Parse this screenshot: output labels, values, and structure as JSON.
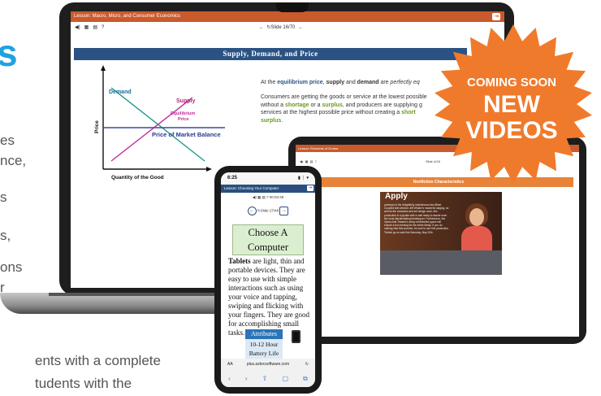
{
  "left_copy": {
    "heading_fragment": "s",
    "lines": [
      "es",
      "nce,",
      "s",
      "s,",
      "ons",
      "r"
    ],
    "bottom_lines": [
      "ents with a complete",
      "tudents with the"
    ]
  },
  "laptop": {
    "topbar_title": "Lesson: Macro, Micro, and Consumer Economics",
    "toolbar_icons": [
      "◀)",
      "▦",
      "▤",
      "?"
    ],
    "slide_nav": "Slide 16/70",
    "slide_title": "Supply, Demand, and Price",
    "chart": {
      "demand_label": "Demand",
      "supply_label": "Supply",
      "equilibrium_label_1": "Equilibrium",
      "equilibrium_label_2": "Price",
      "market_label": "Price of Market Balance",
      "y_axis": "Price",
      "x_axis": "Quantity of the Good"
    },
    "para1": {
      "a": "At the ",
      "b": "equilibrium price",
      "c": ", ",
      "d": "supply",
      "e": " and ",
      "f": "demand",
      "g": " are ",
      "h": "perfectly eq"
    },
    "para2": {
      "l1": "Consumers are getting the goods or service at the lowest possible",
      "l2a": "without a ",
      "l2b": "shortage",
      "l2c": " or a ",
      "l2d": "surplus",
      "l2e": ", and producers are supplying g",
      "l3a": "services at the highest possible price without creating a ",
      "l3b": "short",
      "l4a": "surplus",
      "l4b": "."
    }
  },
  "tablet": {
    "topbar_title": "Lesson: Elements of Drama",
    "slide_nav": "Slide 4/18",
    "banner": "Nonfiction Characteristics",
    "video_title": "Apply",
    "video_text": "portrayal of the delightfully mischievous fast-ffllasi. Coupled with director Jeff Whaler's masterful staging, as well as the costumes and set design work, this production is a joyride with a cast ready to dazzle even the most discriminating theatergoer. Furthermore, the Opera Arts Theatre's newly refurbished space will ensure a fun evening for the entire family. If you do nothing else this summer, be sure to see this production. Tickets go on sale this Saturday, May 20th."
  },
  "phone": {
    "status_time": "6:25",
    "status_right": "▮ ⋮ ▾",
    "topbar_title": "Lesson: Choosing Your Computer",
    "toolbar": "◀)  ▦  ▤  ?     00:03:49",
    "slide_nav": "Slide 27/48",
    "title_box_1": "Choose A",
    "title_box_2": "Computer",
    "body_bold": "Tablets",
    "body_rest": " are light, thin and portable devices. They are easy to use with simple interactions such as using your voice and tapping, swiping and flicking with your fingers. They are good for accomplishing small tasks.",
    "attr_head": "Attributes",
    "attr_cell_1": "10-12 Hour",
    "attr_cell_2": "Battery Life",
    "url_left": "AA",
    "url": "plus.aztecsoftware.com",
    "url_right": "↻",
    "bottom_icons": [
      "‹",
      "›",
      "⇧",
      "▢",
      "⧉"
    ]
  },
  "burst": {
    "line1": "COMING SOON",
    "line2": "NEW",
    "line3": "VIDEOS",
    "color": "#f07a2c"
  },
  "colors": {
    "accent_blue": "#1fa2e0",
    "lesson_orange": "#c95a2c",
    "title_navy": "#2a5384"
  }
}
